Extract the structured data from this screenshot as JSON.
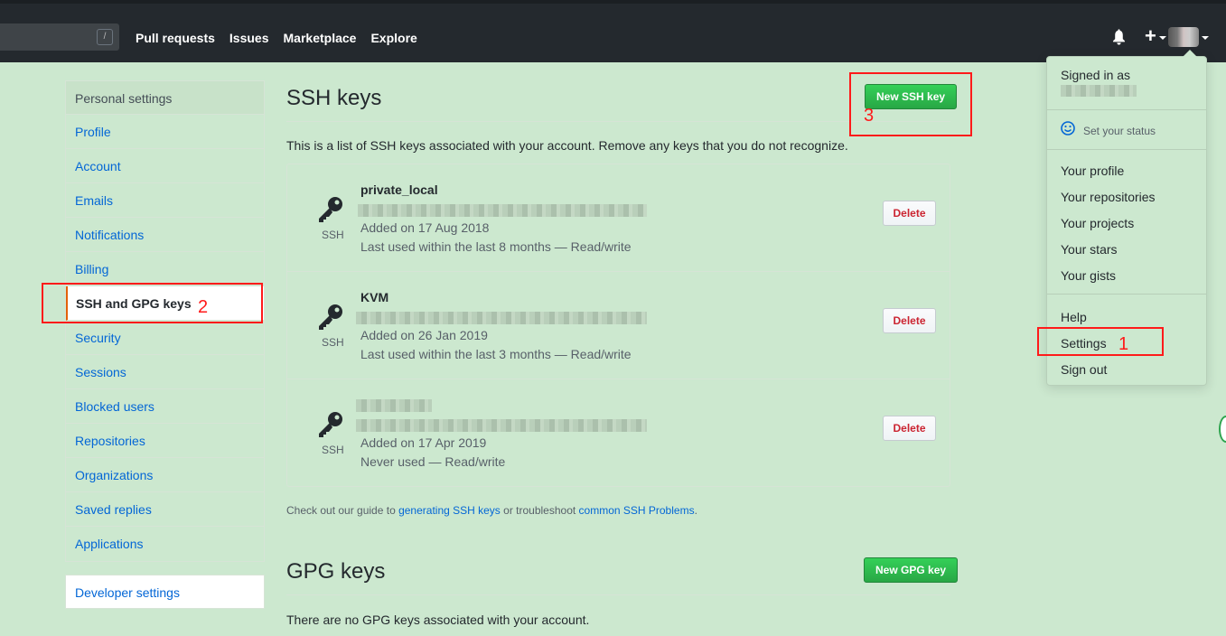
{
  "header": {
    "search_hint": "/",
    "nav": [
      "Pull requests",
      "Issues",
      "Marketplace",
      "Explore"
    ],
    "plus_label": "+"
  },
  "sidebar": {
    "heading": "Personal settings",
    "items": [
      {
        "label": "Profile"
      },
      {
        "label": "Account"
      },
      {
        "label": "Emails"
      },
      {
        "label": "Notifications"
      },
      {
        "label": "Billing"
      },
      {
        "label": "SSH and GPG keys",
        "active": true
      },
      {
        "label": "Security"
      },
      {
        "label": "Sessions"
      },
      {
        "label": "Blocked users"
      },
      {
        "label": "Repositories"
      },
      {
        "label": "Organizations"
      },
      {
        "label": "Saved replies"
      },
      {
        "label": "Applications"
      }
    ],
    "developer": "Developer settings"
  },
  "ssh": {
    "title": "SSH keys",
    "new_button": "New SSH key",
    "description": "This is a list of SSH keys associated with your account. Remove any keys that you do not recognize.",
    "keys": [
      {
        "title": "private_local",
        "type": "SSH",
        "added": "Added on 17 Aug 2018",
        "used": "Last used within the last 8 months — Read/write",
        "delete": "Delete"
      },
      {
        "title": "KVM",
        "type": "SSH",
        "added": "Added on 26 Jan 2019",
        "used": "Last used within the last 3 months — Read/write",
        "delete": "Delete"
      },
      {
        "title": "",
        "type": "SSH",
        "added": "Added on 17 Apr 2019",
        "used": "Never used — Read/write",
        "delete": "Delete"
      }
    ],
    "guide_prefix": "Check out our guide to ",
    "guide_link1": "generating SSH keys",
    "guide_middle": " or troubleshoot ",
    "guide_link2": "common SSH Problems",
    "guide_suffix": "."
  },
  "gpg": {
    "title": "GPG keys",
    "new_button": "New GPG key",
    "description": "There are no GPG keys associated with your account."
  },
  "dropdown": {
    "signed_in_as": "Signed in as",
    "set_status": "Set your status",
    "items_group1": [
      "Your profile",
      "Your repositories",
      "Your projects",
      "Your stars",
      "Your gists"
    ],
    "help": "Help",
    "settings": "Settings",
    "sign_out": "Sign out"
  },
  "annotations": {
    "step1": "1",
    "step2": "2",
    "step3": "3"
  },
  "colors": {
    "annotation": "#ff1a1a",
    "green_button": "#28a745",
    "link": "#0366d6",
    "delete": "#cb2431"
  }
}
